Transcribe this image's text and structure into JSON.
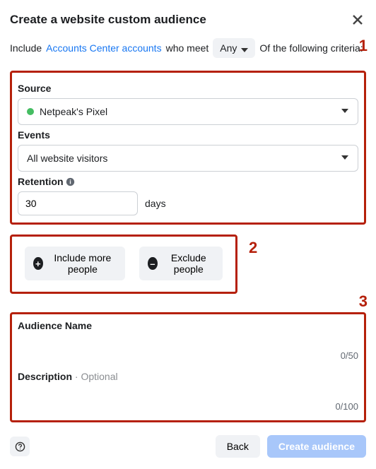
{
  "header": {
    "title": "Create a website custom audience"
  },
  "intro": {
    "pre": "Include",
    "link": "Accounts Center accounts",
    "mid": "who meet",
    "any_label": "Any",
    "post": "Of the following criteria:"
  },
  "annotations": {
    "n1": "1",
    "n2": "2",
    "n3": "3"
  },
  "criteria": {
    "source_label": "Source",
    "source_value": "Netpeak's Pixel",
    "events_label": "Events",
    "events_value": "All website visitors",
    "retention_label": "Retention",
    "retention_value": "30",
    "retention_unit": "days"
  },
  "actions": {
    "include": "Include more people",
    "exclude": "Exclude people"
  },
  "naming": {
    "name_label": "Audience Name",
    "name_value": "",
    "name_counter": "0/50",
    "desc_label": "Description",
    "desc_optional_sep": " · ",
    "desc_optional": "Optional",
    "desc_value": "",
    "desc_counter": "0/100"
  },
  "footer": {
    "back": "Back",
    "create": "Create audience"
  }
}
